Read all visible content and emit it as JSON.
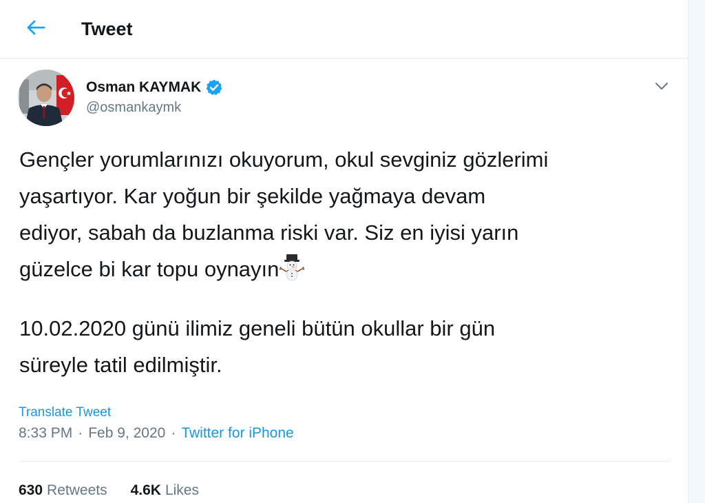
{
  "header": {
    "title": "Tweet",
    "back_icon": "arrow-left-icon"
  },
  "author": {
    "name": "Osman KAYMAK",
    "handle": "@osmankaymk",
    "verified_icon": "verified-badge-icon"
  },
  "tweet": {
    "paragraph1": "Gençler yorumlarınızı okuyorum, okul sevginiz gözlerimi\nyaşartıyor. Kar yoğun bir şekilde yağmaya devam\nediyor, sabah da buzlanma riski var. Siz en iyisi yarın\ngüzelce bi kar topu oynayın",
    "emoji_icon": "snowman-icon",
    "paragraph2": "10.02.2020 günü ilimiz geneli bütün okullar bir gün\nsüreyle tatil edilmiştir.",
    "translate_label": "Translate Tweet",
    "time": "8:33 PM",
    "separator": "·",
    "date": "Feb 9, 2020",
    "source": "Twitter for iPhone"
  },
  "stats": {
    "retweets_count": "630",
    "retweets_label": "Retweets",
    "likes_count": "4.6K",
    "likes_label": "Likes"
  },
  "colors": {
    "accent": "#1da1f2",
    "link": "#1b95e0",
    "secondary_text": "#657786",
    "primary_text": "#14171a"
  }
}
